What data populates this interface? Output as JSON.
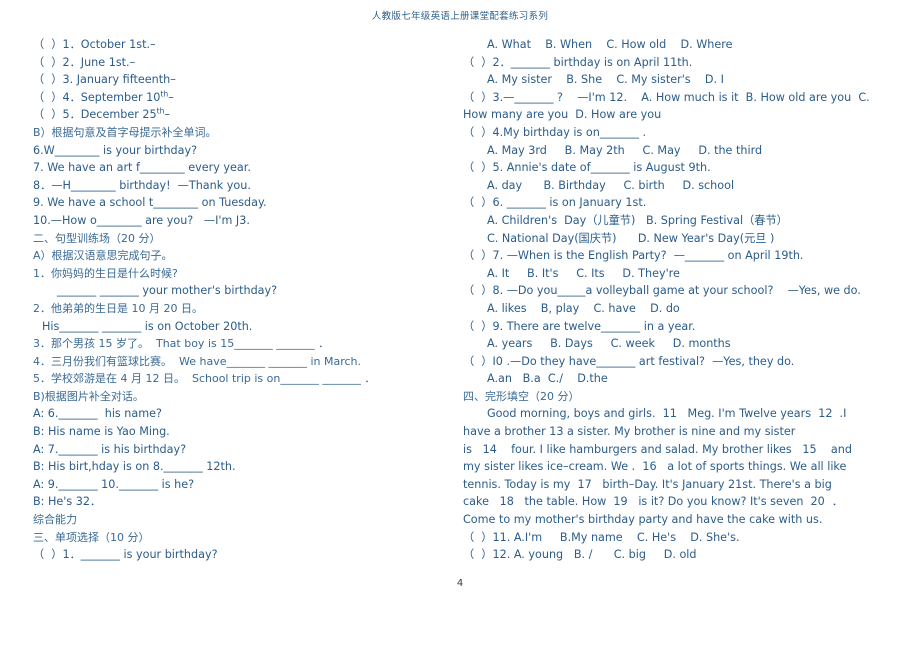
{
  "document": {
    "header": "人教版七年级英语上册课堂配套练习系列",
    "page_number": "4",
    "text_color": "#2b5c8a",
    "background_color": "#ffffff"
  },
  "left_column": {
    "lines": [
      {
        "text": "（  ）1．October 1st.–",
        "indent": "none",
        "script": "en"
      },
      {
        "text": "（  ）2．June 1st.–",
        "indent": "none",
        "script": "en"
      },
      {
        "text": "（  ）3. January fifteenth–",
        "indent": "none",
        "script": "en"
      },
      {
        "text": "（  ）4．September 10th–",
        "indent": "none",
        "script": "en",
        "superscript": "th"
      },
      {
        "text": "（  ）5．December 25th–",
        "indent": "none",
        "script": "en",
        "superscript": "th"
      },
      {
        "text": "B）根据句意及首字母提示补全单词。",
        "indent": "none",
        "script": "cn"
      },
      {
        "text": "6.W________ is your birthday?",
        "indent": "none",
        "script": "en"
      },
      {
        "text": "7. We have an art f________ every year.",
        "indent": "none",
        "script": "en"
      },
      {
        "text": "8．—H________ birthday!  —Thank you.",
        "indent": "none",
        "script": "en"
      },
      {
        "text": "9. We have a school t________ on Tuesday.",
        "indent": "none",
        "script": "en"
      },
      {
        "text": "10.—How o________ are you?   —I'm J3.",
        "indent": "none",
        "script": "en"
      },
      {
        "text": "二、句型训练场（20 分）",
        "indent": "none",
        "script": "cn"
      },
      {
        "text": "A）根据汉语意思完成句子。",
        "indent": "none",
        "script": "cn"
      },
      {
        "text": "1．你妈妈的生日是什么时候?",
        "indent": "none",
        "script": "cn"
      },
      {
        "text": "_______ _______ your mother's birthday?",
        "indent": "indent2",
        "script": "en"
      },
      {
        "text": "2．他弟弟的生日是 10 月 20 日。",
        "indent": "none",
        "script": "cn"
      },
      {
        "text": "His_______ _______ is on October 20th.",
        "indent": "indent3",
        "script": "en"
      },
      {
        "text": "3．那个男孩 15 岁了。  That boy is 15_______ _______ ．",
        "indent": "none",
        "script": "cn"
      },
      {
        "text": "4．三月份我们有篮球比赛。  We have_______ _______ in March.",
        "indent": "none",
        "script": "cn"
      },
      {
        "text": "5．学校郊游是在 4 月 12 日。  School trip is on_______ _______ ．",
        "indent": "none",
        "script": "cn"
      },
      {
        "text": "B)根据图片补全对话。",
        "indent": "none",
        "script": "cn"
      },
      {
        "text": "A: 6._______  his name?",
        "indent": "none",
        "script": "en"
      },
      {
        "text": "B: His name is Yao Ming.",
        "indent": "none",
        "script": "en"
      },
      {
        "text": "A: 7._______ is his birthday?",
        "indent": "none",
        "script": "en"
      },
      {
        "text": "B: His birt,hday is on 8._______ 12th.",
        "indent": "none",
        "script": "en"
      },
      {
        "text": "A: 9._______ 10._______ is he?",
        "indent": "none",
        "script": "en"
      },
      {
        "text": "B: He's 32．",
        "indent": "none",
        "script": "en"
      },
      {
        "text": "综合能力",
        "indent": "none",
        "script": "cn"
      },
      {
        "text": "三、单项选择（10 分）",
        "indent": "none",
        "script": "cn"
      },
      {
        "text": "（  ）1．_______ is your birthday?",
        "indent": "none",
        "script": "en"
      }
    ]
  },
  "right_column": {
    "lines": [
      {
        "text": "A. What    B. When    C. How old    D. Where",
        "indent": "indent2",
        "script": "en"
      },
      {
        "text": "（  ）2．_______ birthday is on April 11th.",
        "indent": "none",
        "script": "en"
      },
      {
        "text": "A. My sister    B. She    C. My sister's    D. I",
        "indent": "indent2",
        "script": "en"
      },
      {
        "text": "（  ）3.—_______ ?    —I'm 12.    A. How much is it  B. How old are you  C.",
        "indent": "none",
        "script": "en"
      },
      {
        "text": "How many are you  D. How are you",
        "indent": "none",
        "script": "en"
      },
      {
        "text": "（  ）4.My birthday is on_______ .",
        "indent": "none",
        "script": "en"
      },
      {
        "text": "A. May 3rd     B. May 2th     C. May     D. the third",
        "indent": "indent2",
        "script": "en"
      },
      {
        "text": "（  ）5. Annie's date of_______ is August 9th.",
        "indent": "none",
        "script": "en"
      },
      {
        "text": "A. day      B. Birthday     C. birth     D. school",
        "indent": "indent2",
        "script": "en"
      },
      {
        "text": "（  ）6. _______ is on January 1st.",
        "indent": "none",
        "script": "en"
      },
      {
        "text": "A. Children's  Day（儿童节)   B. Spring Festival（春节）",
        "indent": "indent2",
        "script": "en"
      },
      {
        "text": "C. National Day(国庆节)      D. New Year's Day(元旦 )",
        "indent": "indent2",
        "script": "en"
      },
      {
        "text": "（  ）7. —When is the English Party?  —_______ on April 19th.",
        "indent": "none",
        "script": "en"
      },
      {
        "text": "A. It     B. It's     C. Its     D. They're",
        "indent": "indent2",
        "script": "en"
      },
      {
        "text": "（  ）8. —Do you_____a volleyball game at your school?    —Yes, we do.",
        "indent": "none",
        "script": "en"
      },
      {
        "text": "A. likes    B, play    C. have    D. do",
        "indent": "indent2",
        "script": "en"
      },
      {
        "text": "（  ）9. There are twelve_______ in a year.",
        "indent": "none",
        "script": "en"
      },
      {
        "text": "A. years     B. Days     C. week     D. months",
        "indent": "indent2",
        "script": "en"
      },
      {
        "text": "（  ）I0 .—Do they have_______ art festival?  —Yes, they do.",
        "indent": "none",
        "script": "en"
      },
      {
        "text": "A.an   B.a  C./    D.the",
        "indent": "indent2",
        "script": "en"
      },
      {
        "text": "四、完形填空（20 分）",
        "indent": "none",
        "script": "cn"
      },
      {
        "text": "Good morning, boys and girls.  11   Meg. I'm Twelve years  12  .I",
        "indent": "indent2",
        "script": "en"
      },
      {
        "text": "have a brother 13 a sister. My brother is nine and my sister",
        "indent": "none",
        "script": "en"
      },
      {
        "text": "is   14    four. I like hamburgers and salad. My brother likes   15    and",
        "indent": "none",
        "script": "en"
      },
      {
        "text": "my sister likes ice–cream. We .  16   a lot of sports things. We all like",
        "indent": "none",
        "script": "en"
      },
      {
        "text": "tennis. Today is my  17   birth–Day. It's January 21st. There's a big",
        "indent": "none",
        "script": "en"
      },
      {
        "text": "cake   18   the table. How  19   is it? Do you know? It's seven  20  ．",
        "indent": "none",
        "script": "en"
      },
      {
        "text": "Come to my mother's birthday party and have the cake with us.",
        "indent": "none",
        "script": "en"
      },
      {
        "text": "（  ）11. A.I'm     B.My name    C. He's    D. She's.",
        "indent": "none",
        "script": "en"
      },
      {
        "text": "（  ）12. A. young   B. /      C. big     D. old",
        "indent": "none",
        "script": "en"
      }
    ]
  }
}
